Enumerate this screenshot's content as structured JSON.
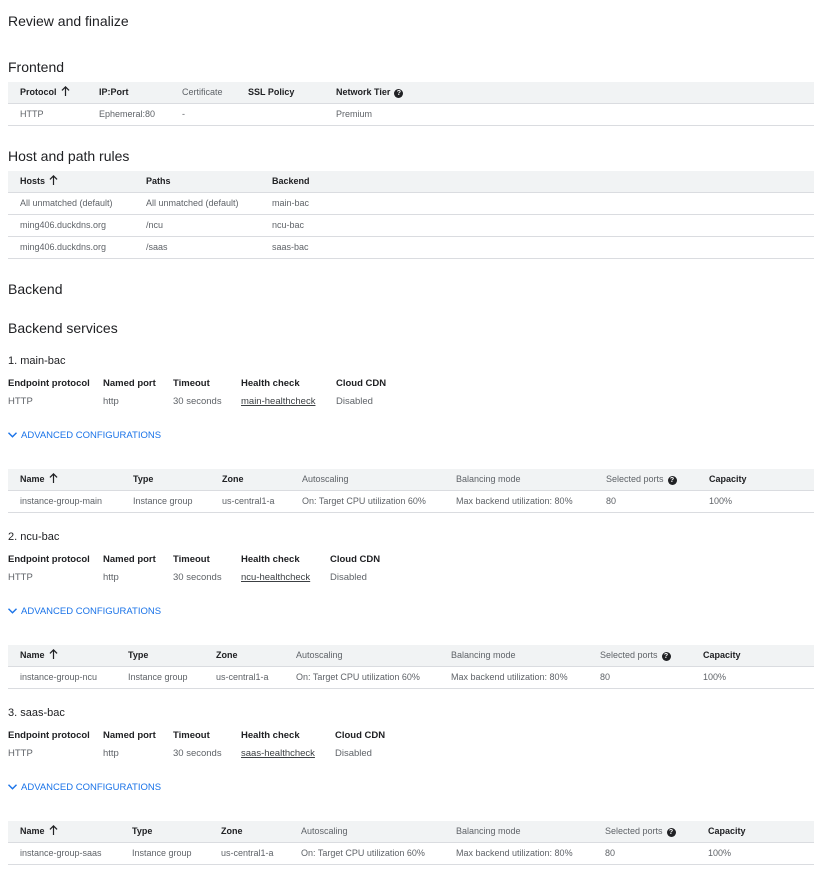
{
  "page_title": "Review and finalize",
  "frontend": {
    "title": "Frontend",
    "columns": [
      "Protocol",
      "IP:Port",
      "Certificate",
      "SSL Policy",
      "Network Tier"
    ],
    "row": [
      "HTTP",
      "Ephemeral:80",
      "-",
      "",
      "Premium"
    ]
  },
  "host_rules": {
    "title": "Host and path rules",
    "columns": [
      "Hosts",
      "Paths",
      "Backend"
    ],
    "rows": [
      [
        "All unmatched (default)",
        "All unmatched (default)",
        "main-bac"
      ],
      [
        "ming406.duckdns.org",
        "/ncu",
        "ncu-bac"
      ],
      [
        "ming406.duckdns.org",
        "/saas",
        "saas-bac"
      ]
    ]
  },
  "backend": {
    "title": "Backend",
    "services_title": "Backend services",
    "kv_labels": [
      "Endpoint protocol",
      "Named port",
      "Timeout",
      "Health check",
      "Cloud CDN"
    ],
    "advanced_label": "ADVANCED CONFIGURATIONS",
    "group_columns": [
      "Name",
      "Type",
      "Zone",
      "Autoscaling",
      "Balancing mode",
      "Selected ports",
      "Capacity"
    ],
    "services": [
      {
        "title": "1. main-bac",
        "values": [
          "HTTP",
          "http",
          "30 seconds",
          "main-healthcheck",
          "Disabled"
        ],
        "group": [
          "instance-group-main",
          "Instance group",
          "us-central1-a",
          "On: Target CPU utilization 60%",
          "Max backend utilization: 80%",
          "80",
          "100%"
        ]
      },
      {
        "title": "2. ncu-bac",
        "values": [
          "HTTP",
          "http",
          "30 seconds",
          "ncu-healthcheck",
          "Disabled"
        ],
        "group": [
          "instance-group-ncu",
          "Instance group",
          "us-central1-a",
          "On: Target CPU utilization 60%",
          "Max backend utilization: 80%",
          "80",
          "100%"
        ]
      },
      {
        "title": "3. saas-bac",
        "values": [
          "HTTP",
          "http",
          "30 seconds",
          "saas-healthcheck",
          "Disabled"
        ],
        "group": [
          "instance-group-saas",
          "Instance group",
          "us-central1-a",
          "On: Target CPU utilization 60%",
          "Max backend utilization: 80%",
          "80",
          "100%"
        ]
      }
    ]
  },
  "help_glyph": "?"
}
